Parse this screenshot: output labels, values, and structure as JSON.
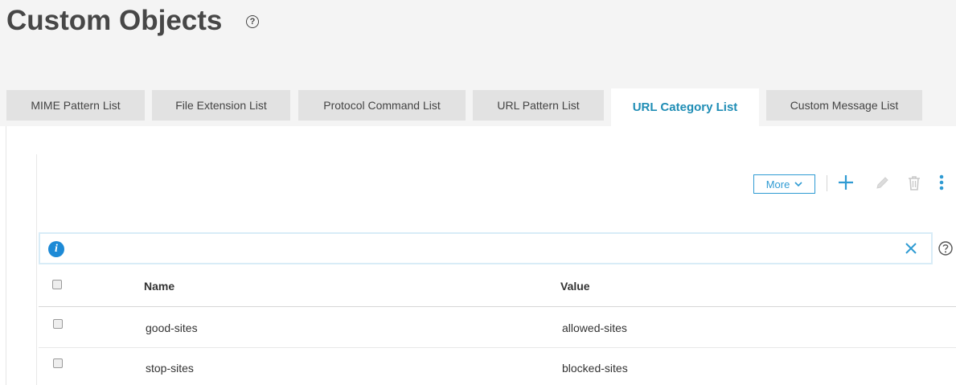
{
  "header": {
    "title": "Custom Objects"
  },
  "tabs": [
    {
      "label": "MIME Pattern List",
      "active": false
    },
    {
      "label": "File Extension List",
      "active": false
    },
    {
      "label": "Protocol Command List",
      "active": false
    },
    {
      "label": "URL Pattern List",
      "active": false
    },
    {
      "label": "URL Category List",
      "active": true
    },
    {
      "label": "Custom Message List",
      "active": false
    }
  ],
  "toolbar": {
    "more_label": "More",
    "icons": [
      "plus-icon",
      "pencil-icon",
      "trash-icon",
      "kebab-menu-icon"
    ]
  },
  "info_bar": {
    "icon": "info-icon",
    "text": "",
    "actions": [
      "close-icon",
      "help-icon"
    ]
  },
  "table": {
    "columns": [
      "Name",
      "Value"
    ],
    "rows": [
      {
        "name": "good-sites",
        "value": "allowed-sites"
      },
      {
        "name": "stop-sites",
        "value": "blocked-sites"
      }
    ]
  },
  "colors": {
    "accent": "#2f9bd3",
    "active_tab_text": "#1f8db5",
    "tab_bg": "#e2e2e2",
    "header_bg": "#f4f4f4",
    "info_icon": "#1d8ad6"
  }
}
